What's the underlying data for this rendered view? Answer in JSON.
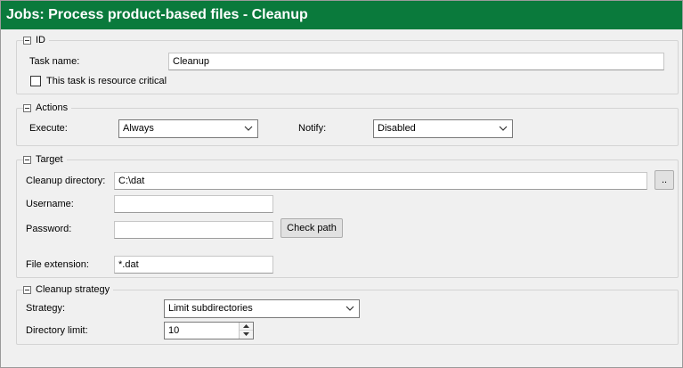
{
  "window": {
    "title": "Jobs: Process product-based files - Cleanup"
  },
  "id_group": {
    "title": "ID",
    "task_name_label": "Task name:",
    "task_name_value": "Cleanup",
    "resource_critical_label": "This task is resource critical",
    "resource_critical_checked": false
  },
  "actions_group": {
    "title": "Actions",
    "execute_label": "Execute:",
    "execute_value": "Always",
    "notify_label": "Notify:",
    "notify_value": "Disabled"
  },
  "target_group": {
    "title": "Target",
    "cleanup_dir_label": "Cleanup directory:",
    "cleanup_dir_value": "C:\\dat",
    "browse_label": "..",
    "username_label": "Username:",
    "username_value": "",
    "password_label": "Password:",
    "password_value": "",
    "check_path_label": "Check path",
    "file_ext_label": "File extension:",
    "file_ext_value": "*.dat"
  },
  "strategy_group": {
    "title": "Cleanup strategy",
    "strategy_label": "Strategy:",
    "strategy_value": "Limit subdirectories",
    "dir_limit_label": "Directory limit:",
    "dir_limit_value": "10"
  },
  "colors": {
    "titlebar": "#0a7a3c",
    "background": "#f0f0f0"
  },
  "icons": [
    "collapse-icon",
    "chevron-down-icon",
    "spin-up-icon",
    "spin-down-icon"
  ]
}
